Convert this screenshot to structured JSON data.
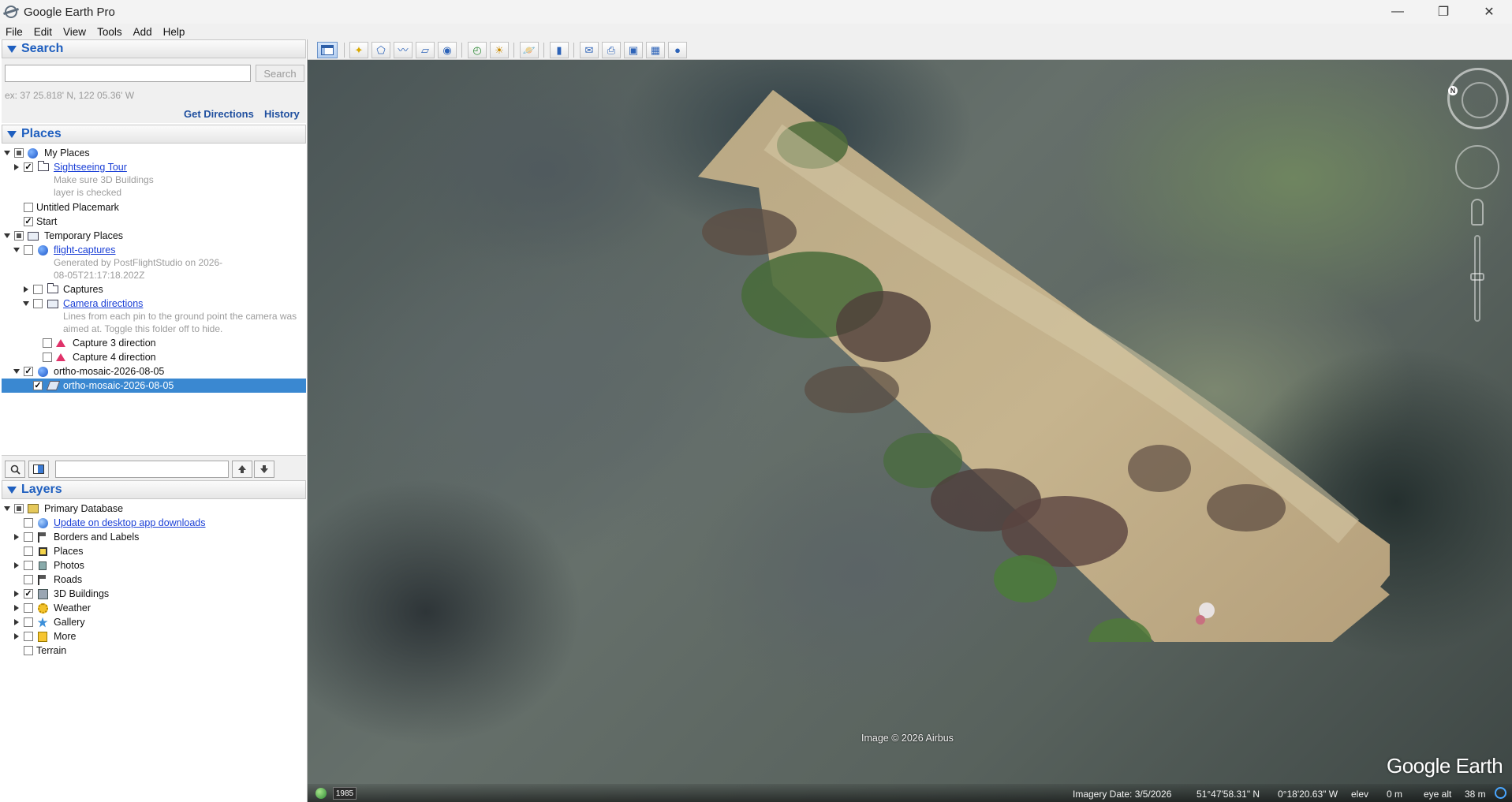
{
  "window": {
    "title": "Google Earth Pro",
    "icon": "google-earth-app-icon",
    "controls": {
      "minimize": "—",
      "maximize": "❐",
      "close": "✕"
    }
  },
  "menu": [
    "File",
    "Edit",
    "View",
    "Tools",
    "Add",
    "Help"
  ],
  "search": {
    "header": "Search",
    "input_value": "",
    "button": "Search",
    "hint": "ex: 37 25.818' N, 122 05.36' W",
    "get_directions": "Get Directions",
    "history": "History"
  },
  "places": {
    "header": "Places",
    "my_places": "My Places",
    "sightseeing_tour": "Sightseeing Tour",
    "sightseeing_desc": "Make sure 3D Buildings layer is checked",
    "untitled_placemark": "Untitled Placemark",
    "start": "Start",
    "temporary_places": "Temporary Places",
    "flight_captures": "flight-captures",
    "flight_captures_desc": "Generated by PostFlightStudio on 2026-08-05T21:17:18.202Z",
    "captures": "Captures",
    "camera_directions": "Camera directions",
    "camera_directions_desc": "Lines from each pin to the ground point the camera was aimed at. Toggle this folder off to hide.",
    "capture3": "Capture 3 direction",
    "capture4": "Capture 4 direction",
    "ortho_folder": "ortho-mosaic-2026-08-05",
    "ortho_overlay": "ortho-mosaic-2026-08-05"
  },
  "layers": {
    "header": "Layers",
    "primary_db": "Primary Database",
    "update": "Update on desktop app downloads",
    "borders": "Borders and Labels",
    "places": "Places",
    "photos": "Photos",
    "roads": "Roads",
    "buildings": "3D Buildings",
    "weather": "Weather",
    "gallery": "Gallery",
    "more": "More",
    "terrain": "Terrain"
  },
  "map": {
    "copyright": "Image © 2026 Airbus",
    "logo": "Google Earth",
    "compass_n": "N",
    "year": "1985",
    "status": {
      "imagery_date": "Imagery Date: 3/5/2026",
      "lat": "51°47'58.31\" N",
      "lon": "0°18'20.63\" W",
      "elev_label": "elev",
      "elev_value": "0 m",
      "eye_label": "eye alt",
      "eye_value": "38 m"
    }
  }
}
